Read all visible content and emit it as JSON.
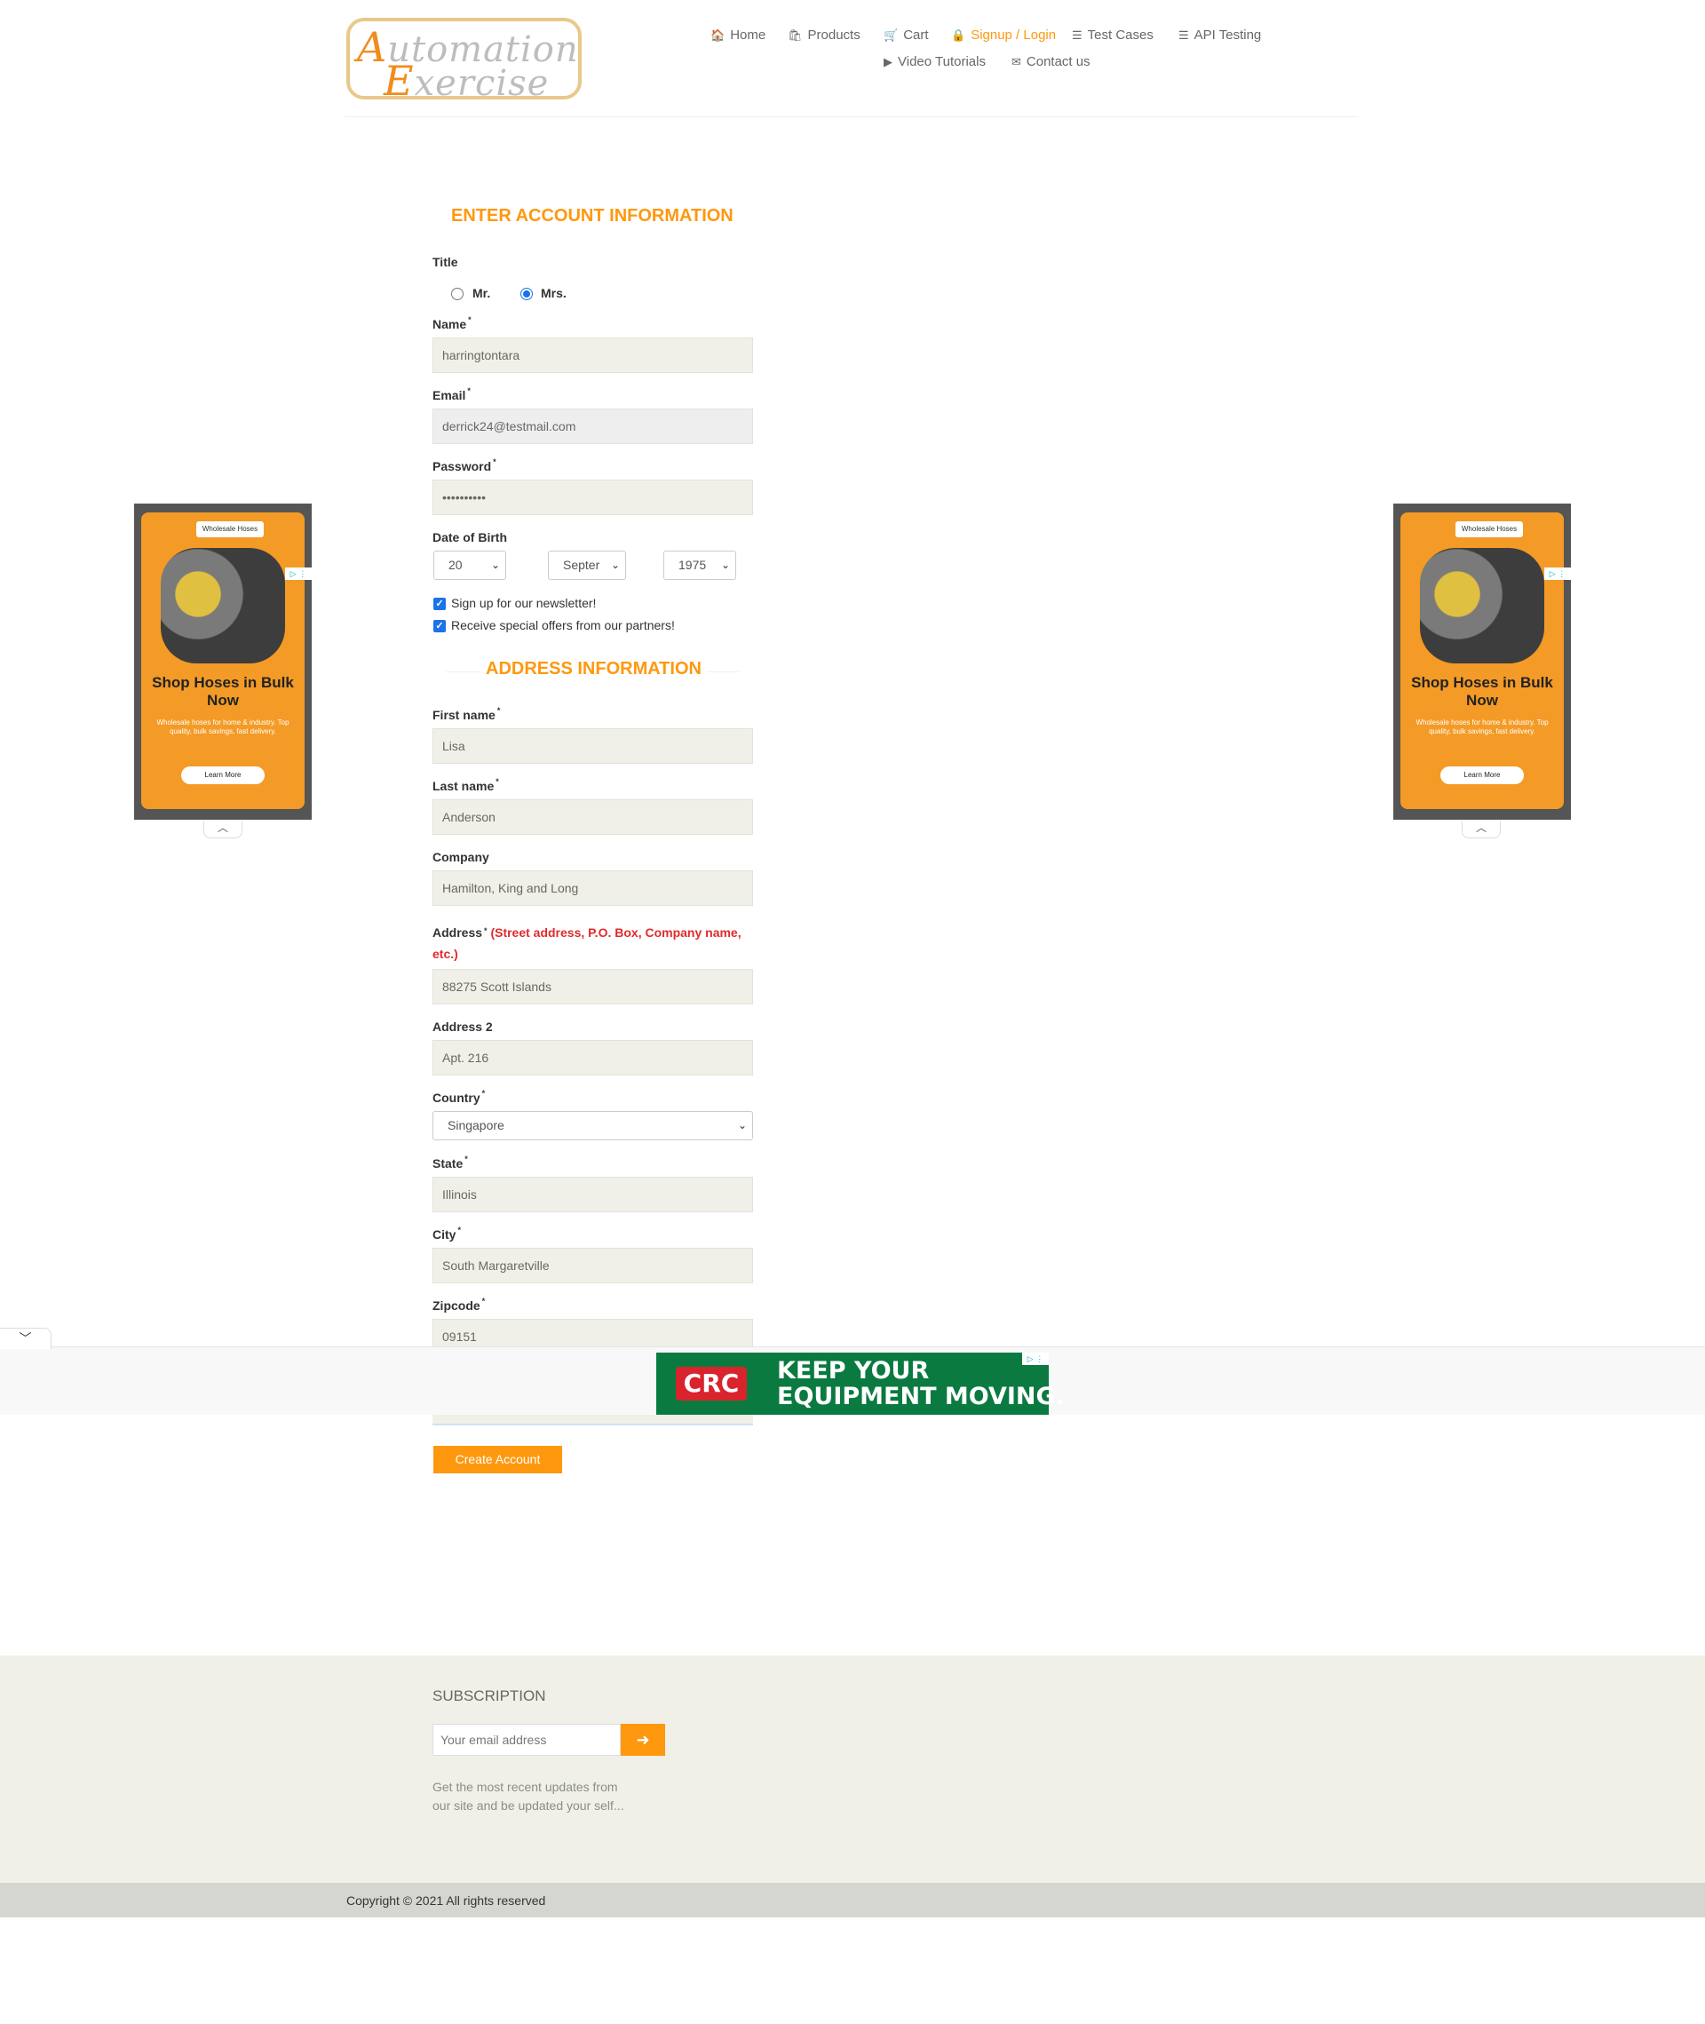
{
  "logo": {
    "line1_cap": "A",
    "line1_rest": "utomation",
    "line2_cap": "E",
    "line2_rest": "xercise"
  },
  "nav": {
    "home": "Home",
    "products": "Products",
    "cart": "Cart",
    "signup": "Signup / Login",
    "test_cases": "Test Cases",
    "api_testing": "API Testing",
    "video": "Video Tutorials",
    "contact": "Contact us",
    "home_icon": "🏠",
    "products_icon": "🛍",
    "cart_icon": "🛒",
    "signup_icon": "🔒",
    "list_icon": "☰",
    "video_icon": "▶",
    "contact_icon": "✉"
  },
  "form": {
    "heading": "ENTER ACCOUNT INFORMATION",
    "title_label": "Title",
    "mr": "Mr.",
    "mrs": "Mrs.",
    "title_selected": "Mrs.",
    "name_label": "Name",
    "name_value": "harringtontara",
    "email_label": "Email",
    "email_value": "derrick24@testmail.com",
    "password_label": "Password",
    "password_value": "••••••••••",
    "dob_label": "Date of Birth",
    "dob_day": "20",
    "dob_month": "Septer",
    "dob_year": "1975",
    "newsletter": "Sign up for our newsletter!",
    "offers": "Receive special offers from our partners!",
    "address_heading": "ADDRESS INFORMATION",
    "first_name_label": "First name",
    "first_name_value": "Lisa",
    "last_name_label": "Last name",
    "last_name_value": "Anderson",
    "company_label": "Company",
    "company_value": "Hamilton, King and Long",
    "address_label": "Address",
    "address_hint": "(Street address, P.O. Box, Company name,",
    "address_hint2": "etc.)",
    "address_value": "88275 Scott Islands",
    "address2_label": "Address 2",
    "address2_value": "Apt. 216",
    "country_label": "Country",
    "country_value": "Singapore",
    "state_label": "State",
    "state_value": "Illinois",
    "city_label": "City",
    "city_value": "South Margaretville",
    "zip_label": "Zipcode",
    "zip_value": "09151",
    "required_mark": "*",
    "create_button": "Create Account"
  },
  "ads": {
    "side_brand": "Wholesale Hoses",
    "side_title": "Shop Hoses in Bulk Now",
    "side_sub": "Wholesale hoses for home & industry. Top quality, bulk savings, fast delivery.",
    "side_button": "Learn More",
    "banner_logo": "CRC",
    "banner_line1": "KEEP YOUR",
    "banner_line2": "EQUIPMENT MOVING.",
    "adchoice": "▷ ⋮"
  },
  "footer": {
    "subscription_title": "SUBSCRIPTION",
    "email_placeholder": "Your email address",
    "subscribe_icon": "➜",
    "note": "Get the most recent updates from our site and be updated your self...",
    "copyright": "Copyright © 2021 All rights reserved"
  },
  "colors": {
    "accent": "#fe980f",
    "input_bg": "#f0f0e9",
    "footer_bg": "#f0f0e9",
    "copy_bg": "#d6d6d0",
    "hint_red": "#e02b2b"
  }
}
